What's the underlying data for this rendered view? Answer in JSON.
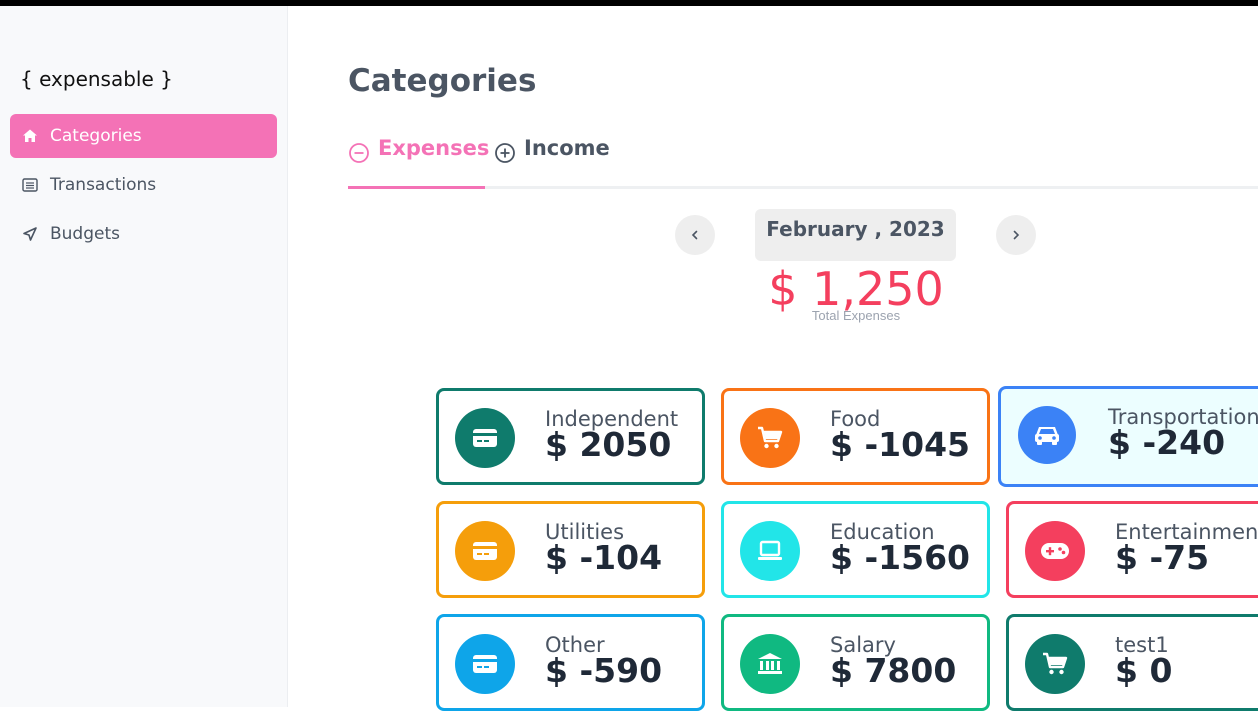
{
  "app": {
    "logo": "{ expensable }"
  },
  "sidebar": {
    "items": [
      {
        "label": "Categories",
        "icon": "home-icon",
        "active": true
      },
      {
        "label": "Transactions",
        "icon": "list-icon",
        "active": false
      },
      {
        "label": "Budgets",
        "icon": "send-icon",
        "active": false
      }
    ]
  },
  "main": {
    "title": "Categories",
    "tabs": [
      {
        "label": "Expenses",
        "icon": "minus-circle-icon",
        "active": true
      },
      {
        "label": "Income",
        "icon": "plus-circle-icon",
        "active": false
      }
    ],
    "period": "February , 2023",
    "total_amount": "$ 1,250",
    "total_label": "Total Expenses",
    "colors": {
      "accent": "#f472b6",
      "total": "#f43f5e"
    }
  },
  "categories": [
    {
      "name": "Independent",
      "amount": "$ 2050",
      "icon": "credit-card-icon",
      "color": "#0f7b6c"
    },
    {
      "name": "Food",
      "amount": "$ -1045",
      "icon": "cart-icon",
      "color": "#f97316"
    },
    {
      "name": "Transportation",
      "amount": "$ -240",
      "icon": "car-icon",
      "color": "#3b82f6"
    },
    {
      "name": "Utilities",
      "amount": "$ -104",
      "icon": "credit-card-icon",
      "color": "#f59e0b"
    },
    {
      "name": "Education",
      "amount": "$ -1560",
      "icon": "laptop-icon",
      "color": "#22e5e8"
    },
    {
      "name": "Entertainment",
      "amount": "$ -75",
      "icon": "gamepad-icon",
      "color": "#f43f5e"
    },
    {
      "name": "Other",
      "amount": "$ -590",
      "icon": "credit-card-icon",
      "color": "#0ea5e9"
    },
    {
      "name": "Salary",
      "amount": "$ 7800",
      "icon": "bank-icon",
      "color": "#10b981"
    },
    {
      "name": "test1",
      "amount": "$ 0",
      "icon": "cart-icon",
      "color": "#0f7b6c"
    }
  ]
}
